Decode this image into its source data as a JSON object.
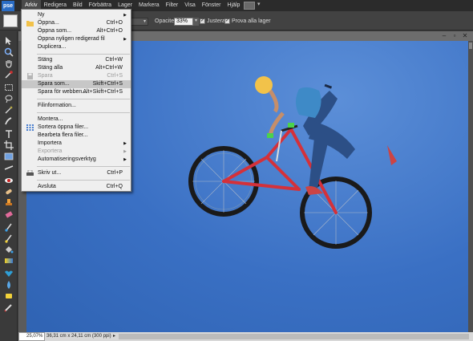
{
  "app": {
    "logo": "pse"
  },
  "menubar": {
    "items": [
      "Arkiv",
      "Redigera",
      "Bild",
      "Förbättra",
      "Lager",
      "Markera",
      "Filter",
      "Visa",
      "Fönster",
      "Hjälp"
    ],
    "active": "Arkiv"
  },
  "options": {
    "mode_value": "",
    "opacity_label": "Opacitet:",
    "opacity_value": "33%",
    "checkbox1": {
      "label": "Justera",
      "checked": true
    },
    "checkbox2": {
      "label": "Prova alla lager",
      "checked": true
    }
  },
  "file_menu": {
    "items": [
      {
        "label": "Ny",
        "shortcut": "",
        "submenu": true
      },
      {
        "label": "Öppna...",
        "shortcut": "Ctrl+O",
        "icon": "folder-icon"
      },
      {
        "label": "Öppna som...",
        "shortcut": "Alt+Ctrl+O"
      },
      {
        "label": "Öppna nyligen redigerad fil",
        "shortcut": "",
        "submenu": true
      },
      {
        "label": "Duplicera...",
        "shortcut": ""
      },
      {
        "label": "Stäng",
        "shortcut": "Ctrl+W"
      },
      {
        "label": "Stäng alla",
        "shortcut": "Alt+Ctrl+W"
      },
      {
        "label": "Spara",
        "shortcut": "Ctrl+S",
        "disabled": true,
        "icon": "save-icon"
      },
      {
        "label": "Spara som...",
        "shortcut": "Skift+Ctrl+S",
        "highlighted": true
      },
      {
        "label": "Spara för webben...",
        "shortcut": "Alt+Skift+Ctrl+S"
      },
      {
        "label": "Filinformation...",
        "shortcut": ""
      },
      {
        "label": "Montera...",
        "shortcut": ""
      },
      {
        "label": "Sortera öppna filer...",
        "shortcut": "",
        "icon": "grid-icon"
      },
      {
        "label": "Bearbeta flera filer...",
        "shortcut": ""
      },
      {
        "label": "Importera",
        "shortcut": "",
        "submenu": true
      },
      {
        "label": "Exportera",
        "shortcut": "",
        "submenu": true,
        "disabled": true
      },
      {
        "label": "Automatiseringsverktyg",
        "shortcut": "",
        "submenu": true
      },
      {
        "label": "Skriv ut...",
        "shortcut": "Ctrl+P",
        "icon": "printer-icon"
      },
      {
        "label": "Avsluta",
        "shortcut": "Ctrl+Q"
      }
    ]
  },
  "status": {
    "zoom": "25,07%",
    "doc_info": "36,31 cm x 24,11 cm (300 ppi)",
    "arrow": "▸"
  },
  "colors": {
    "foreground": "#b21e0f",
    "background": "#000000",
    "sky": "#3a70c4"
  }
}
